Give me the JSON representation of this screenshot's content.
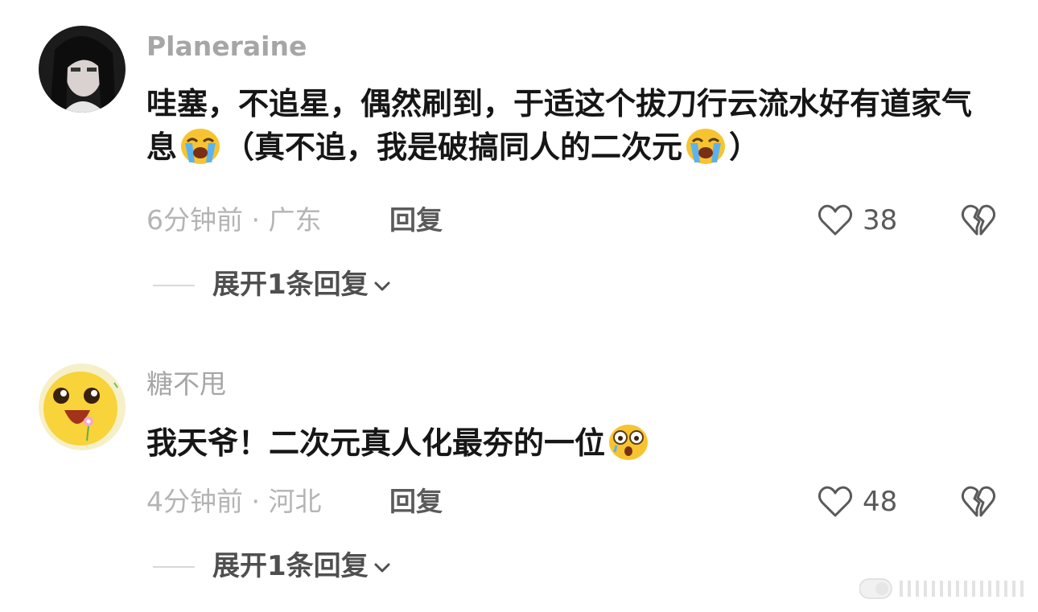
{
  "comments": [
    {
      "username": "Planeraine",
      "text_parts": [
        "哇塞，不追星，偶然刷到，于适这个拔刀行云流水好有道家气息",
        "（真不追，我是破搞同人的二次元",
        "）"
      ],
      "time_location": "6分钟前 · 广东",
      "reply_label": "回复",
      "likes": "38",
      "expand_label": "展开1条回复"
    },
    {
      "username": "糖不甩",
      "text_parts": [
        "我天爷！二次元真人化最夯的一位"
      ],
      "time_location": "4分钟前 · 河北",
      "reply_label": "回复",
      "likes": "48",
      "expand_label": "展开1条回复"
    }
  ],
  "icons": {
    "like": "heart-outline-icon",
    "dislike": "broken-heart-icon",
    "expand": "chevron-down-icon",
    "emoji_cry": "loudly-crying-face-emoji",
    "emoji_shock": "astonished-face-emoji"
  },
  "colors": {
    "username": "#a6a6a6",
    "text": "#161616",
    "meta": "#b4b4b4",
    "action": "#5b5b5b"
  }
}
